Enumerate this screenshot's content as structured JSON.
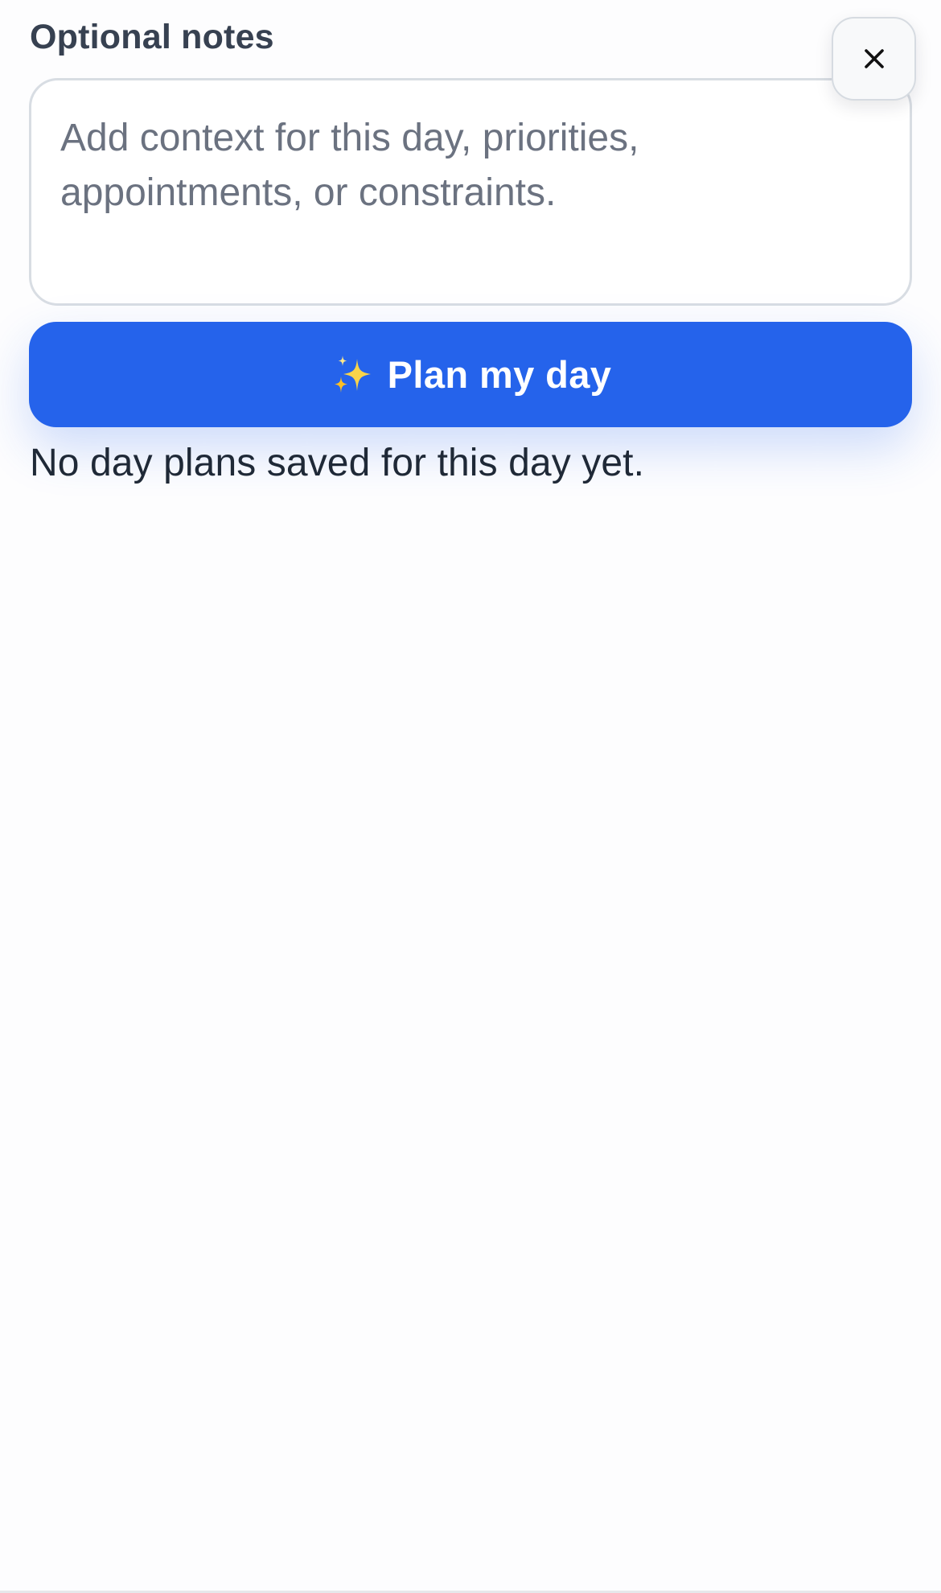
{
  "notes": {
    "label": "Optional notes",
    "placeholder": "Add context for this day, priorities, appointments, or constraints.",
    "value": ""
  },
  "close_button": {
    "icon": "close-icon",
    "aria_label": "Close"
  },
  "plan_button": {
    "label": "Plan my day",
    "icon": "sparkles-icon",
    "color": "#2563eb"
  },
  "empty_state": {
    "text": "No day plans saved for this day yet."
  }
}
